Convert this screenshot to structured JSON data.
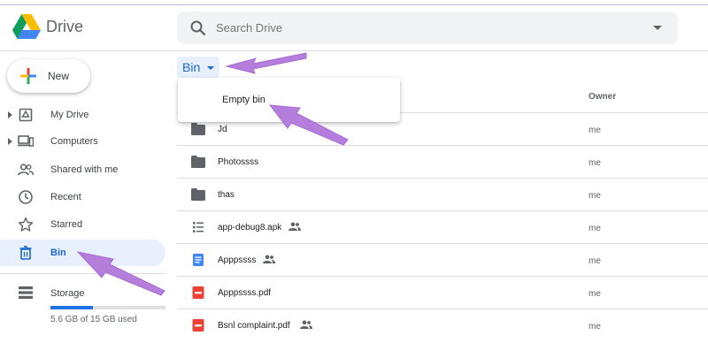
{
  "app": {
    "brand": "Drive",
    "accent": "#1a73e8",
    "annotation_color": "#b57edc"
  },
  "search": {
    "placeholder": "Search Drive"
  },
  "sidebar": {
    "new_label": "New",
    "items": [
      {
        "label": "My Drive",
        "icon": "drive-icon",
        "expandable": true
      },
      {
        "label": "Computers",
        "icon": "computers-icon",
        "expandable": true
      },
      {
        "label": "Shared with me",
        "icon": "people-icon",
        "expandable": false
      },
      {
        "label": "Recent",
        "icon": "clock-icon",
        "expandable": false
      },
      {
        "label": "Starred",
        "icon": "star-icon",
        "expandable": false
      },
      {
        "label": "Bin",
        "icon": "trash-icon",
        "expandable": false,
        "active": true
      }
    ],
    "storage": {
      "label": "Storage",
      "usage_text": "5.6 GB of 15 GB used",
      "used_fraction": 0.373
    }
  },
  "location": {
    "label": "Bin"
  },
  "menu": {
    "empty_bin": "Empty bin"
  },
  "table": {
    "owner_header": "Owner",
    "rows": [
      {
        "name": "Jd",
        "icon": "folder-icon",
        "shared": false,
        "owner": "me"
      },
      {
        "name": "Photossss",
        "icon": "folder-icon",
        "shared": false,
        "owner": "me"
      },
      {
        "name": "thas",
        "icon": "folder-icon",
        "shared": false,
        "owner": "me"
      },
      {
        "name": "app-debug8.apk",
        "icon": "apk-icon",
        "shared": true,
        "owner": "me"
      },
      {
        "name": "Apppssss",
        "icon": "docs-icon",
        "shared": true,
        "owner": "me"
      },
      {
        "name": "Apppssss.pdf",
        "icon": "pdf-icon",
        "shared": false,
        "owner": "me"
      },
      {
        "name": "Bsnl complaint.pdf",
        "icon": "pdf-icon",
        "shared": true,
        "owner": "me"
      }
    ]
  }
}
